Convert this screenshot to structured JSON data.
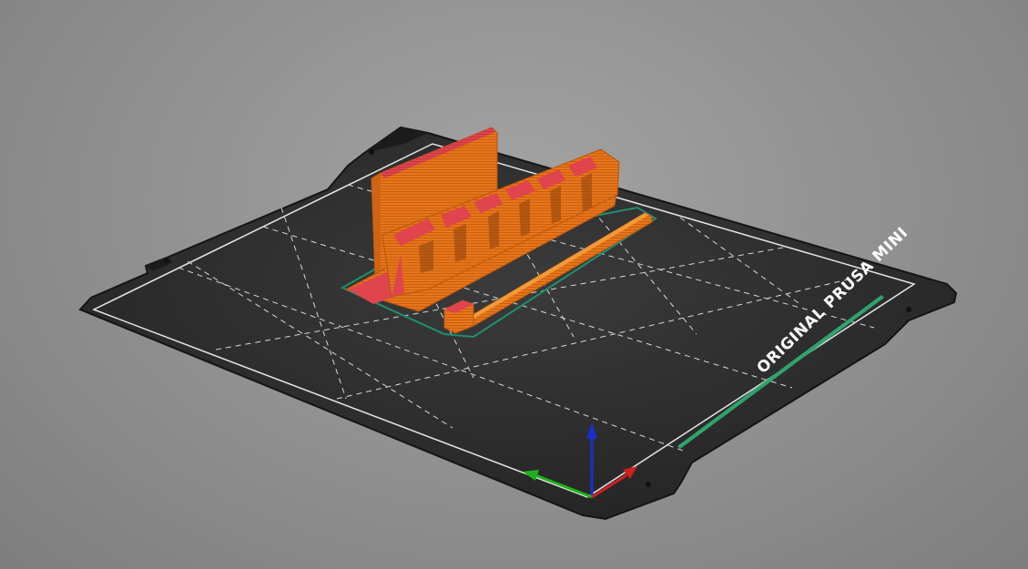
{
  "scene": {
    "view": "3D preview",
    "bed": {
      "brand_label": "ORIGINAL PRUSA MINI",
      "surface_color": "#2a2a2a",
      "grid_color": "#d8d8d8",
      "accent_strip_color": "#2fa36b"
    },
    "objects": [
      {
        "name": "organizer-stand",
        "color": "#e8761a",
        "top_color": "#e0444c"
      },
      {
        "name": "long-rod",
        "color": "#e8761a"
      },
      {
        "name": "small-block",
        "color": "#e8761a"
      }
    ],
    "axes": {
      "x_color": "#d01f1f",
      "y_color": "#1fb21f",
      "z_color": "#1a2fd0"
    },
    "background_color": "#959595"
  }
}
